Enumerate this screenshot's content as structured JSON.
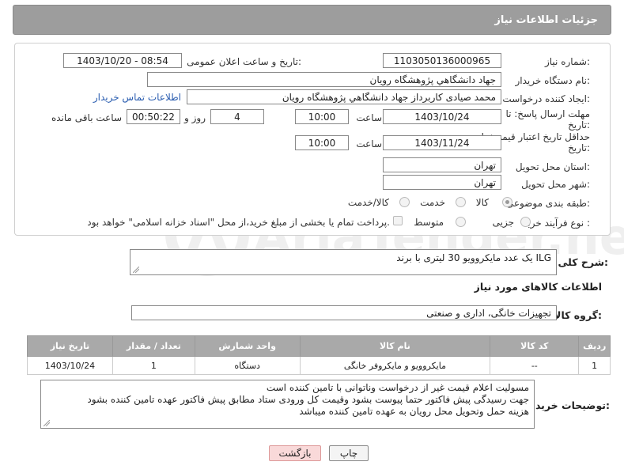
{
  "header": {
    "title": "جزئیات اطلاعات نیاز"
  },
  "form": {
    "need_number_label": "شماره نیاز:",
    "need_number": "1103050136000965",
    "announce_label": "تاریخ و ساعت اعلان عمومی:",
    "announce_value": "1403/10/20 - 08:54",
    "buyer_org_label": "نام دستگاه خریدار:",
    "buyer_org": "جهاد دانشگاهي پژوهشگاه رويان",
    "requester_label": "ایجاد کننده درخواست:",
    "requester": "محمد صیادی کاربرداز جهاد دانشگاهي پژوهشگاه رويان",
    "contact_link": "اطلاعات تماس خریدار",
    "deadline_label_1": "مهلت ارسال پاسخ: تا",
    "deadline_label_2": "تاریخ:",
    "deadline_date": "1403/10/24",
    "time_label": "ساعت",
    "deadline_time": "10:00",
    "days_value": "4",
    "days_label": "روز و",
    "remaining_time": "00:50:22",
    "remaining_label": "ساعت باقی مانده",
    "validity_label_1": "حداقل تاریخ اعتبار قیمت: تا",
    "validity_label_2": "تاریخ:",
    "validity_date": "1403/11/24",
    "validity_time": "10:00",
    "province_label": "استان محل تحویل:",
    "province": "تهران",
    "city_label": "شهر محل تحویل:",
    "city": "تهران",
    "category_label": "طبقه بندی موضوعی:",
    "category_options": [
      "کالا",
      "خدمت",
      "کالا/خدمت"
    ],
    "category_selected": "کالا",
    "process_label": "نوع فرآیند خرید :",
    "process_options": [
      "جزیی",
      "متوسط"
    ],
    "payment_note": "پرداخت تمام یا بخشی از مبلغ خرید،از محل \"اسناد خزانه اسلامی\" خواهد بود."
  },
  "description": {
    "label": "شرح کلی نیاز:",
    "value": "یک عدد مایکروویو 30 لیتری با برند ILG"
  },
  "goods_info": {
    "title": "اطلاعات کالاهای مورد نیاز",
    "group_label": "گروه کالا:",
    "group_value": "تجهیزات خانگی، اداری و صنعتی"
  },
  "table": {
    "headers": [
      "ردیف",
      "کد کالا",
      "نام کالا",
      "واحد شمارش",
      "تعداد / مقدار",
      "تاریخ نیاز"
    ],
    "rows": [
      [
        "1",
        "--",
        "مایکروویو و مایکروفر خانگی",
        "دستگاه",
        "1",
        "1403/10/24"
      ]
    ]
  },
  "buyer_notes": {
    "label": "توضیحات خریدار:",
    "lines": [
      "مسولیت اعلام قیمت  غیر از درخواست وناتوانی با تامین کننده است",
      "جهت رسیدگی پیش فاکتور حتما پیوست بشود وقیمت کل ورودی ستاد مطابق پیش فاکتور عهده تامین کننده بشود",
      "هزینه حمل وتحویل محل رویان به عهده تامین کننده میباشد"
    ]
  },
  "buttons": {
    "print": "چاپ",
    "back": "بازگشت"
  },
  "watermark": {
    "text": "AriaTender.neT"
  },
  "colors": {
    "header_bg": "#9d9d9d",
    "table_header_bg": "#a9a9a9",
    "back_button_bg": "#f9d9d9",
    "link": "#2a5db0"
  }
}
